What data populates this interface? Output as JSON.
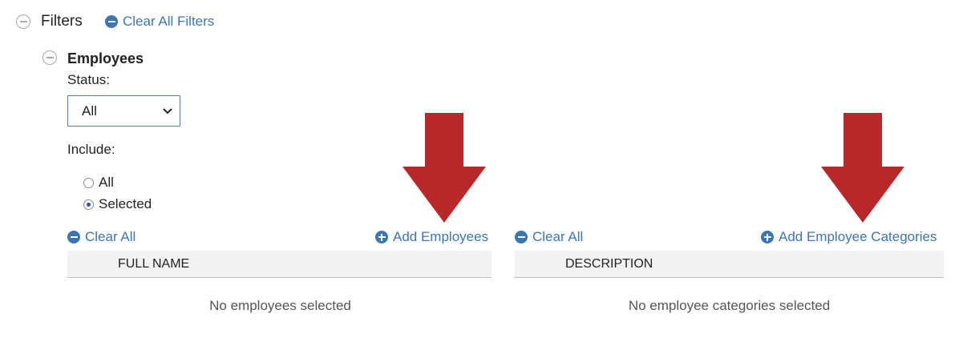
{
  "filters": {
    "title": "Filters",
    "clear_all_label": "Clear All Filters"
  },
  "employees": {
    "title": "Employees",
    "status_label": "Status:",
    "status_value": "All",
    "include_label": "Include:",
    "include_options": [
      {
        "label": "All",
        "checked": false
      },
      {
        "label": "Selected",
        "checked": true
      }
    ]
  },
  "employee_panel": {
    "clear_label": "Clear All",
    "add_label": "Add Employees",
    "column_header": "FULL NAME",
    "empty_message": "No employees selected"
  },
  "category_panel": {
    "clear_label": "Clear All",
    "add_label": "Add Employee Categories",
    "column_header": "DESCRIPTION",
    "empty_message": "No employee categories selected"
  },
  "colors": {
    "link": "#3b76b3",
    "arrow": "#b8282b",
    "header_bg": "#f2f2f2"
  },
  "icons": {
    "collapse": "minus-circle-outline-icon",
    "clear": "minus-circle-icon",
    "add": "plus-circle-icon",
    "select_caret": "chevron-down-icon",
    "annotation": "red-down-arrow-icon"
  }
}
